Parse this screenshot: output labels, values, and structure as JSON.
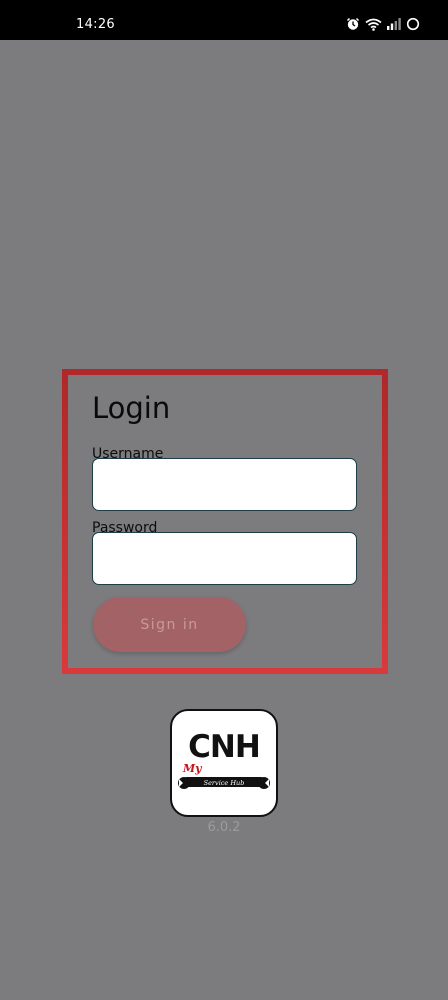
{
  "status_bar": {
    "time": "14:26",
    "icons": [
      "alarm-icon",
      "wifi-icon",
      "signal-icon",
      "battery-icon"
    ]
  },
  "login": {
    "title": "Login",
    "username_label": "Username",
    "username_value": "",
    "password_label": "Password",
    "password_value": "",
    "sign_in_label": "Sign in"
  },
  "logo": {
    "brand": "CNH",
    "script": "My",
    "subtitle": "Service Hub"
  },
  "version": "6.0.2",
  "colors": {
    "background": "#7c7b7e",
    "card_border": "#c7302f",
    "button": "#a36366",
    "button_text": "#c79a9c"
  }
}
